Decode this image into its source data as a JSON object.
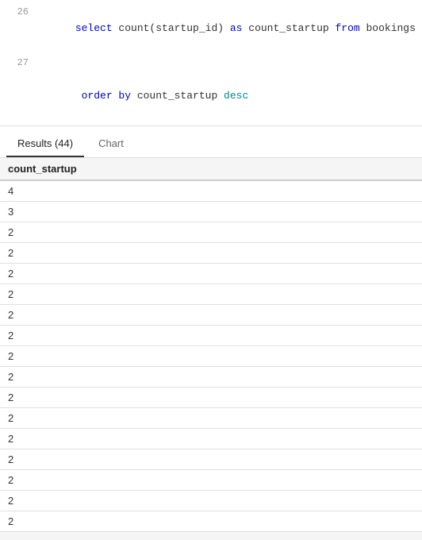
{
  "code": {
    "lines": [
      {
        "number": "26",
        "tokens": [
          {
            "text": "select ",
            "style": "kw-blue"
          },
          {
            "text": "count(startup_id) ",
            "style": "normal"
          },
          {
            "text": "as ",
            "style": "kw-blue"
          },
          {
            "text": "count_startup ",
            "style": "normal"
          },
          {
            "text": "from ",
            "style": "kw-blue"
          },
          {
            "text": "bookings  gr",
            "style": "normal"
          }
        ]
      },
      {
        "number": "27",
        "tokens": [
          {
            "text": "order ",
            "style": "kw-blue"
          },
          {
            "text": "by ",
            "style": "kw-blue"
          },
          {
            "text": "count_startup ",
            "style": "normal"
          },
          {
            "text": "desc",
            "style": "kw-teal"
          }
        ]
      }
    ]
  },
  "tabs": {
    "results_label": "Results (44)",
    "chart_label": "Chart"
  },
  "table": {
    "column_header": "count_startup",
    "rows": [
      {
        "value": "4"
      },
      {
        "value": "3"
      },
      {
        "value": "2"
      },
      {
        "value": "2"
      },
      {
        "value": "2"
      },
      {
        "value": "2"
      },
      {
        "value": "2"
      },
      {
        "value": "2"
      },
      {
        "value": "2"
      },
      {
        "value": "2"
      },
      {
        "value": "2"
      },
      {
        "value": "2"
      },
      {
        "value": "2"
      },
      {
        "value": "2"
      },
      {
        "value": "2"
      },
      {
        "value": "2"
      },
      {
        "value": "2"
      }
    ]
  }
}
